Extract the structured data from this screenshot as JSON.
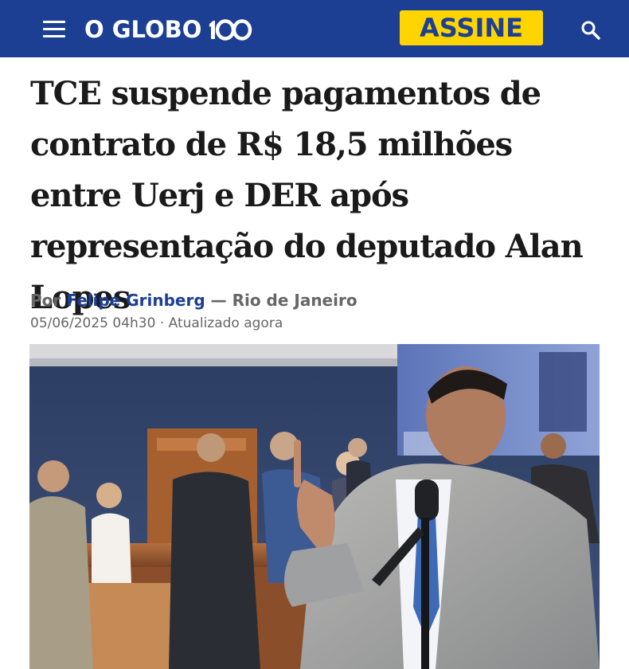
{
  "header": {
    "menu_icon": "hamburger-menu-icon",
    "logo_text": "O GLOBO",
    "logo_anniversary": "100",
    "subscribe_label": "ASSINE",
    "search_icon": "search-icon",
    "colors": {
      "brand_blue": "#1c3f94",
      "subscribe_yellow": "#ffd500"
    }
  },
  "article": {
    "headline": "TCE suspende pagamentos de contrato de R$ 18,5 milhões entre Uerj e DER após representação do deputado Alan Lopes",
    "byline_prefix": "Por",
    "author": "Felipe Grinberg",
    "location": "— Rio de Janeiro",
    "date": "05/06/2025 04h30",
    "updated": "· Atualizado agora",
    "photo_icon": "news-photo"
  }
}
